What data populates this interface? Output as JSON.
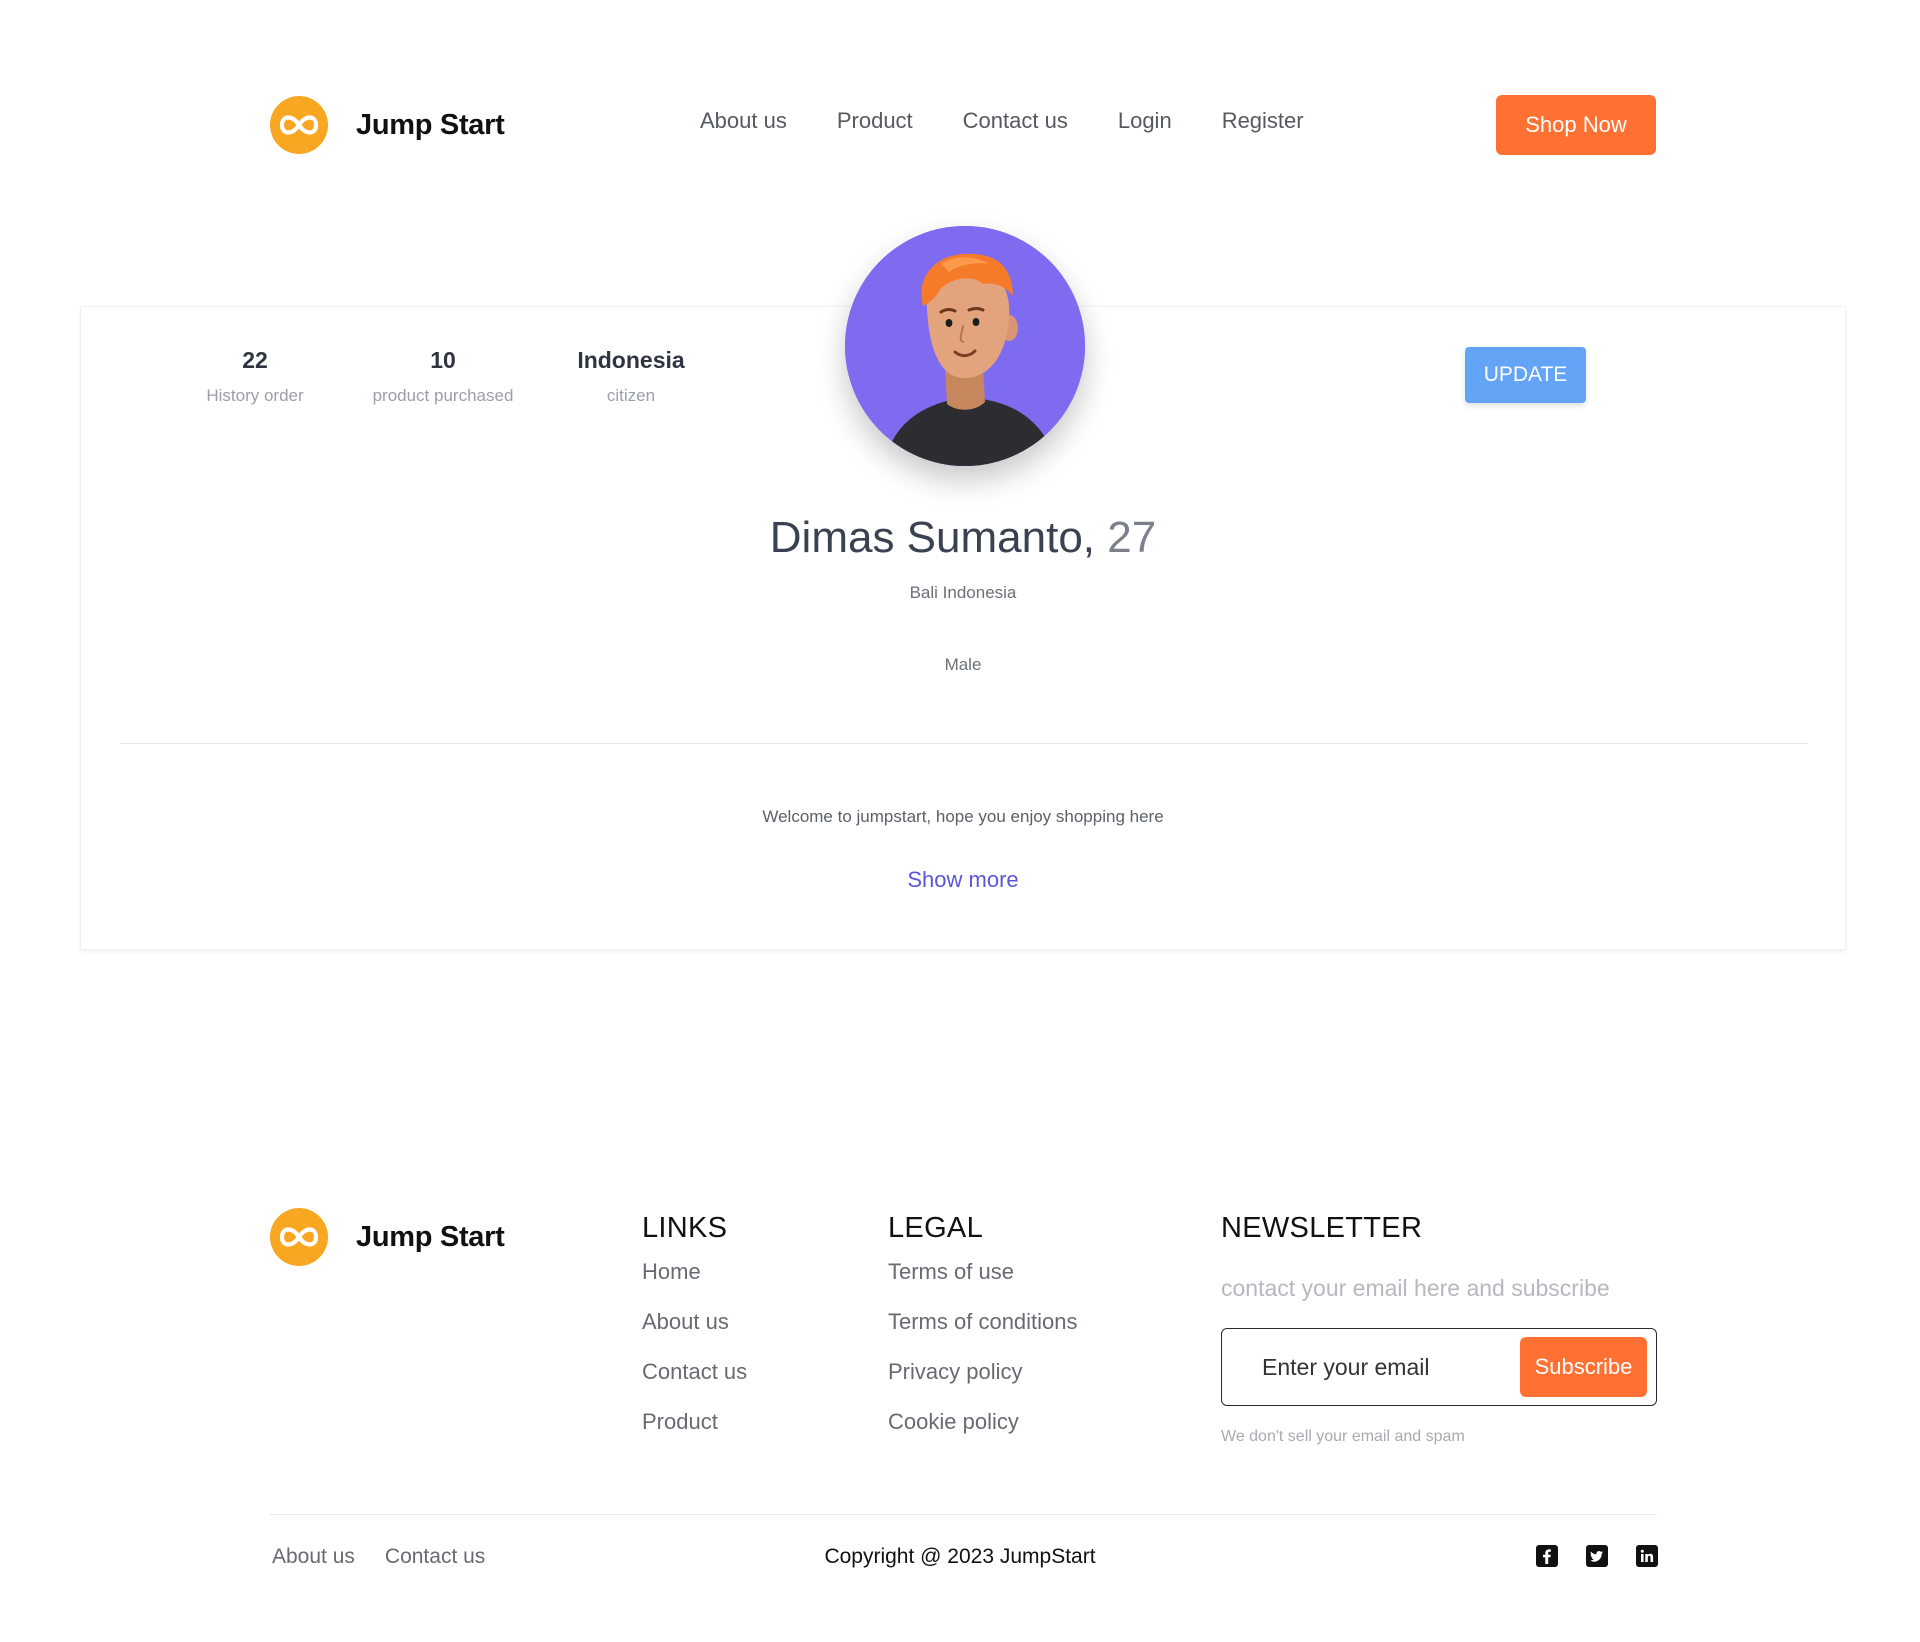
{
  "header": {
    "brand_name": "Jump Start",
    "nav": [
      "About us",
      "Product",
      "Contact us",
      "Login",
      "Register"
    ],
    "cta_label": "Shop Now"
  },
  "profile": {
    "stats": [
      {
        "value": "22",
        "label": "History order"
      },
      {
        "value": "10",
        "label": "product purchased"
      },
      {
        "value": "Indonesia",
        "label": "citizen"
      }
    ],
    "update_label": "UPDATE",
    "name": "Dimas Sumanto,",
    "age": "27",
    "location": "Bali Indonesia",
    "gender": "Male",
    "bio": "Welcome to jumpstart, hope you enjoy shopping here",
    "show_more_label": "Show more"
  },
  "footer": {
    "brand_name": "Jump Start",
    "links": {
      "title": "LINKS",
      "items": [
        "Home",
        "About us",
        "Contact us",
        "Product"
      ]
    },
    "legal": {
      "title": "LEGAL",
      "items": [
        "Terms of use",
        "Terms of conditions",
        "Privacy policy",
        "Cookie policy"
      ]
    },
    "newsletter": {
      "title": "NEWSLETTER",
      "subtitle": "contact your email here and subscribe",
      "placeholder": "Enter your email",
      "button_label": "Subscribe",
      "note": "We don't sell your email and spam"
    },
    "bottom_links": [
      "About us",
      "Contact us"
    ],
    "copyright": "Copyright @ 2023 JumpStart",
    "socials": [
      "facebook-icon",
      "twitter-icon",
      "linkedin-icon"
    ]
  },
  "colors": {
    "accent": "#ff7133",
    "logo": "#f9a623",
    "update_button": "#63a4f7",
    "avatar_bg": "#7e6bf0",
    "link": "#5b57d6"
  }
}
